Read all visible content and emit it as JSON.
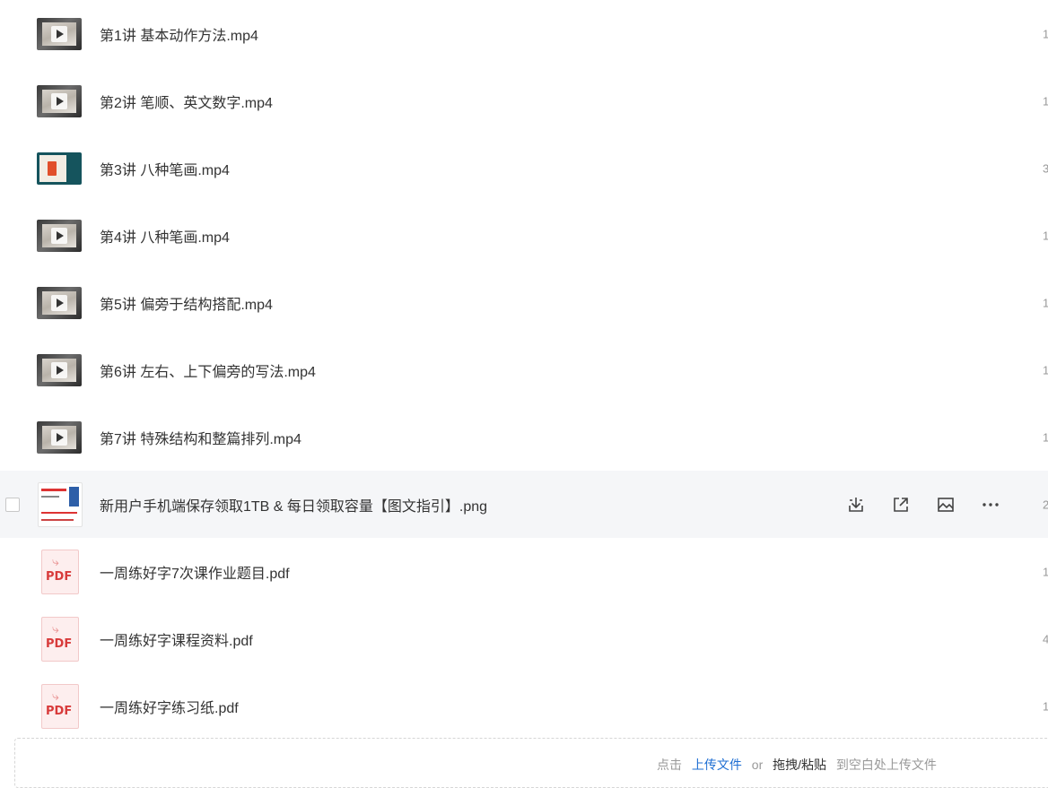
{
  "files": [
    {
      "name": "第1讲 基本动作方法.mp4",
      "type": "video",
      "trail": "1"
    },
    {
      "name": "第2讲 笔顺、英文数字.mp4",
      "type": "video",
      "trail": "1"
    },
    {
      "name": "第3讲 八种笔画.mp4",
      "type": "video-teal",
      "trail": "3"
    },
    {
      "name": "第4讲 八种笔画.mp4",
      "type": "video",
      "trail": "1"
    },
    {
      "name": "第5讲 偏旁于结构搭配.mp4",
      "type": "video",
      "trail": "1"
    },
    {
      "name": "第6讲 左右、上下偏旁的写法.mp4",
      "type": "video",
      "trail": "1"
    },
    {
      "name": "第7讲 特殊结构和整篇排列.mp4",
      "type": "video",
      "trail": "1"
    },
    {
      "name": "新用户手机端保存领取1TB & 每日领取容量【图文指引】.png",
      "type": "image",
      "trail": "2",
      "hovered": true
    },
    {
      "name": "一周练好字7次课作业题目.pdf",
      "type": "pdf",
      "trail": "1"
    },
    {
      "name": "一周练好字课程资料.pdf",
      "type": "pdf",
      "trail": "4"
    },
    {
      "name": "一周练好字练习纸.pdf",
      "type": "pdf",
      "trail": "1"
    }
  ],
  "pdf_label": "PDF",
  "hover_actions": [
    "download-icon",
    "share-icon",
    "preview-image-icon",
    "more-icon"
  ],
  "upload": {
    "prefix": "点击",
    "link": "上传文件",
    "or": "or",
    "drag": "拖拽/粘贴",
    "suffix": "到空白处上传文件"
  },
  "colors": {
    "link": "#1f6fd3",
    "hover_row": "#f5f6f8",
    "pdf_red": "#d83b3b"
  }
}
